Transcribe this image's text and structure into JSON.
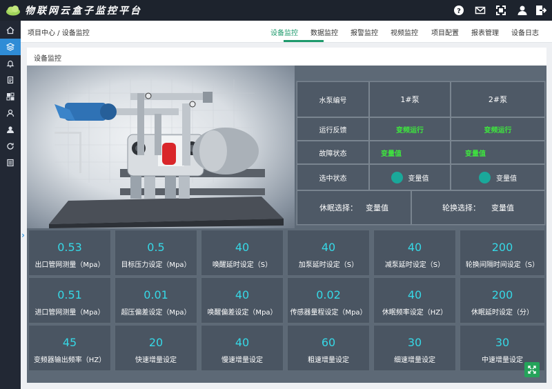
{
  "app": {
    "title": "物联网云盒子监控平台"
  },
  "topbar": {
    "icons": [
      "help-icon",
      "mail-icon",
      "fullscreen-icon",
      "user-icon",
      "logout-icon"
    ]
  },
  "sidebar": {
    "items": [
      "home-icon",
      "layers-icon",
      "bell-icon",
      "document-icon",
      "grid-icon",
      "user-icon",
      "team-icon",
      "refresh-icon",
      "list-icon"
    ],
    "active_index": 1,
    "toggle": "›"
  },
  "breadcrumb": "项目中心 / 设备监控",
  "tabs": [
    "设备监控",
    "数据监控",
    "报警监控",
    "视频监控",
    "项目配置",
    "报表管理",
    "设备日志"
  ],
  "active_tab": 0,
  "card": {
    "title": "设备监控"
  },
  "info_table": {
    "header_label": "水泵编号",
    "pumps": [
      "1#泵",
      "2#泵"
    ],
    "run_label": "运行反馈",
    "run_values": [
      "变频运行",
      "变频运行"
    ],
    "fault_label": "故障状态",
    "fault_values": [
      "变量值",
      "变量值"
    ],
    "select_label": "选中状态",
    "select_values": [
      "变量值",
      "变量值"
    ],
    "sleep_label": "休眠选择：",
    "sleep_value": "变量值",
    "rotate_label": "轮换选择：",
    "rotate_value": "变量值"
  },
  "metrics": [
    {
      "value": "0.53",
      "label": "出口管网测量（Mpa）"
    },
    {
      "value": "0.5",
      "label": "目标压力设定（Mpa）"
    },
    {
      "value": "40",
      "label": "唤醒延时设定（S）"
    },
    {
      "value": "40",
      "label": "加泵延时设定（S）"
    },
    {
      "value": "40",
      "label": "减泵延时设定（S）"
    },
    {
      "value": "200",
      "label": "轮换间隔时间设定（S）"
    },
    {
      "value": "0.51",
      "label": "进口管网测量（Mpa）"
    },
    {
      "value": "0.01",
      "label": "超压偏差设定（Mpa）"
    },
    {
      "value": "40",
      "label": "唤醒偏差设定（Mpa）"
    },
    {
      "value": "0.02",
      "label": "传感器量程设定（Mpa）"
    },
    {
      "value": "40",
      "label": "休眠频率设定（HZ）"
    },
    {
      "value": "200",
      "label": "休眠延时设定（分）"
    },
    {
      "value": "45",
      "label": "变频器输出频率（HZ）"
    },
    {
      "value": "20",
      "label": "快速增量设定"
    },
    {
      "value": "40",
      "label": "慢速增量设定"
    },
    {
      "value": "60",
      "label": "粗速增量设定"
    },
    {
      "value": "30",
      "label": "细速增量设定"
    },
    {
      "value": "30",
      "label": "中速增量设定"
    }
  ],
  "colors": {
    "accent": "#1d9a6c",
    "metric_value": "#36d8e6",
    "status_green": "#3ee63e",
    "sidebar_active": "#2f8cd6"
  }
}
